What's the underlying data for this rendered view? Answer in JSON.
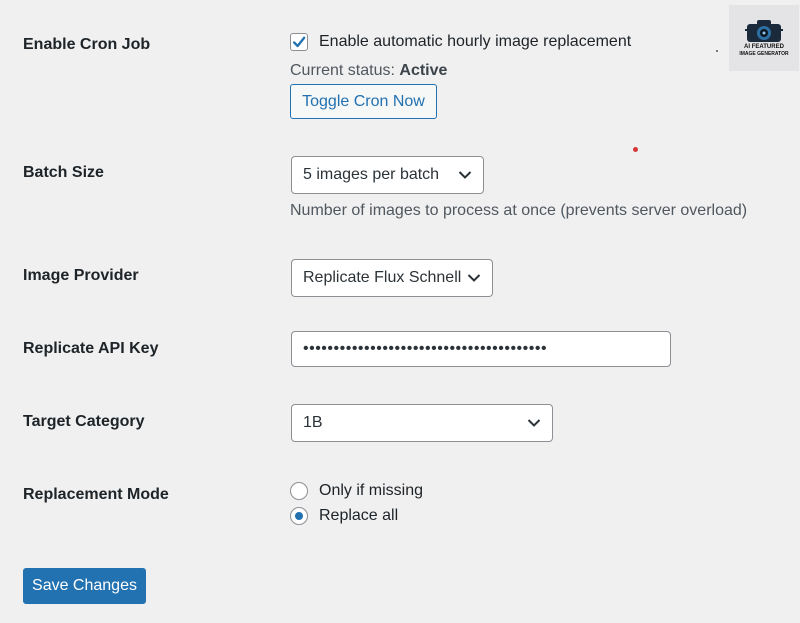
{
  "settings": {
    "cron": {
      "label": "Enable Cron Job",
      "checkbox_label": "Enable automatic hourly image replacement",
      "checked": true,
      "status_prefix": "Current status:",
      "status_value": "Active",
      "toggle_button": "Toggle Cron Now"
    },
    "batch": {
      "label": "Batch Size",
      "selected": "5 images per batch",
      "description": "Number of images to process at once (prevents server overload)"
    },
    "provider": {
      "label": "Image Provider",
      "selected": "Replicate Flux Schnell"
    },
    "api_key": {
      "label": "Replicate API Key",
      "masked_value": "••••••••••••••••••••••••••••••••••••••••"
    },
    "category": {
      "label": "Target Category",
      "selected": "1B"
    },
    "mode": {
      "label": "Replacement Mode",
      "options": [
        {
          "label": "Only if missing",
          "checked": false
        },
        {
          "label": "Replace all",
          "checked": true
        }
      ]
    }
  },
  "actions": {
    "save_label": "Save Changes"
  },
  "logo": {
    "text_line1": "AI FEATURED",
    "text_line2": "IMAGE GENERATOR"
  },
  "colors": {
    "accent": "#2271b1",
    "background": "#f0f0f1",
    "red_dot": "#d63638"
  }
}
